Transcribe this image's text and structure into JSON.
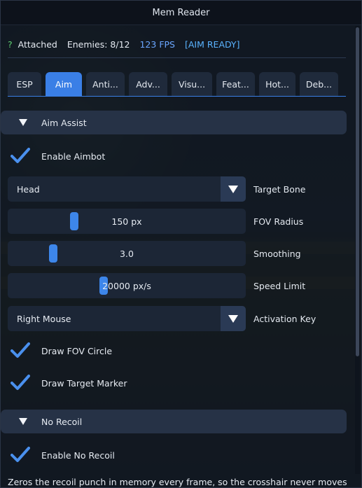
{
  "window": {
    "title": "Mem Reader"
  },
  "status": {
    "indicator": "?",
    "attached": "Attached",
    "enemies": "Enemies: 8/12",
    "fps": "123 FPS",
    "aim_state": "[AIM READY]"
  },
  "tabs": [
    {
      "label": "ESP",
      "active": false
    },
    {
      "label": "Aim",
      "active": true
    },
    {
      "label": "Anti...",
      "active": false
    },
    {
      "label": "Adv...",
      "active": false
    },
    {
      "label": "Visu...",
      "active": false
    },
    {
      "label": "Feat...",
      "active": false
    },
    {
      "label": "Hot...",
      "active": false
    },
    {
      "label": "Deb...",
      "active": false
    }
  ],
  "aim_assist": {
    "header": "Aim Assist",
    "enable_aimbot": {
      "label": "Enable Aimbot",
      "checked": true
    },
    "target_bone": {
      "label": "Target Bone",
      "value": "Head"
    },
    "fov_radius": {
      "label": "FOV Radius",
      "value_text": "150 px",
      "fraction": 0.27
    },
    "smoothing": {
      "label": "Smoothing",
      "value_text": "3.0",
      "fraction": 0.18
    },
    "speed_limit": {
      "label": "Speed Limit",
      "value_text": "20000 px/s",
      "fraction": 0.4
    },
    "activation_key": {
      "label": "Activation Key",
      "value": "Right Mouse"
    },
    "draw_fov_circle": {
      "label": "Draw FOV Circle",
      "checked": true
    },
    "draw_target_marker": {
      "label": "Draw Target Marker",
      "checked": true
    }
  },
  "no_recoil": {
    "header": "No Recoil",
    "enable": {
      "label": "Enable No Recoil",
      "checked": true
    },
    "description": "Zeros the recoil punch in memory every frame, so the crosshair never moves"
  },
  "colors": {
    "accent": "#3a7fe6",
    "check": "#4a90ee",
    "fps": "#6aa6ff",
    "aim_ready": "#5ab3ff",
    "indicator": "#5fcf72"
  }
}
